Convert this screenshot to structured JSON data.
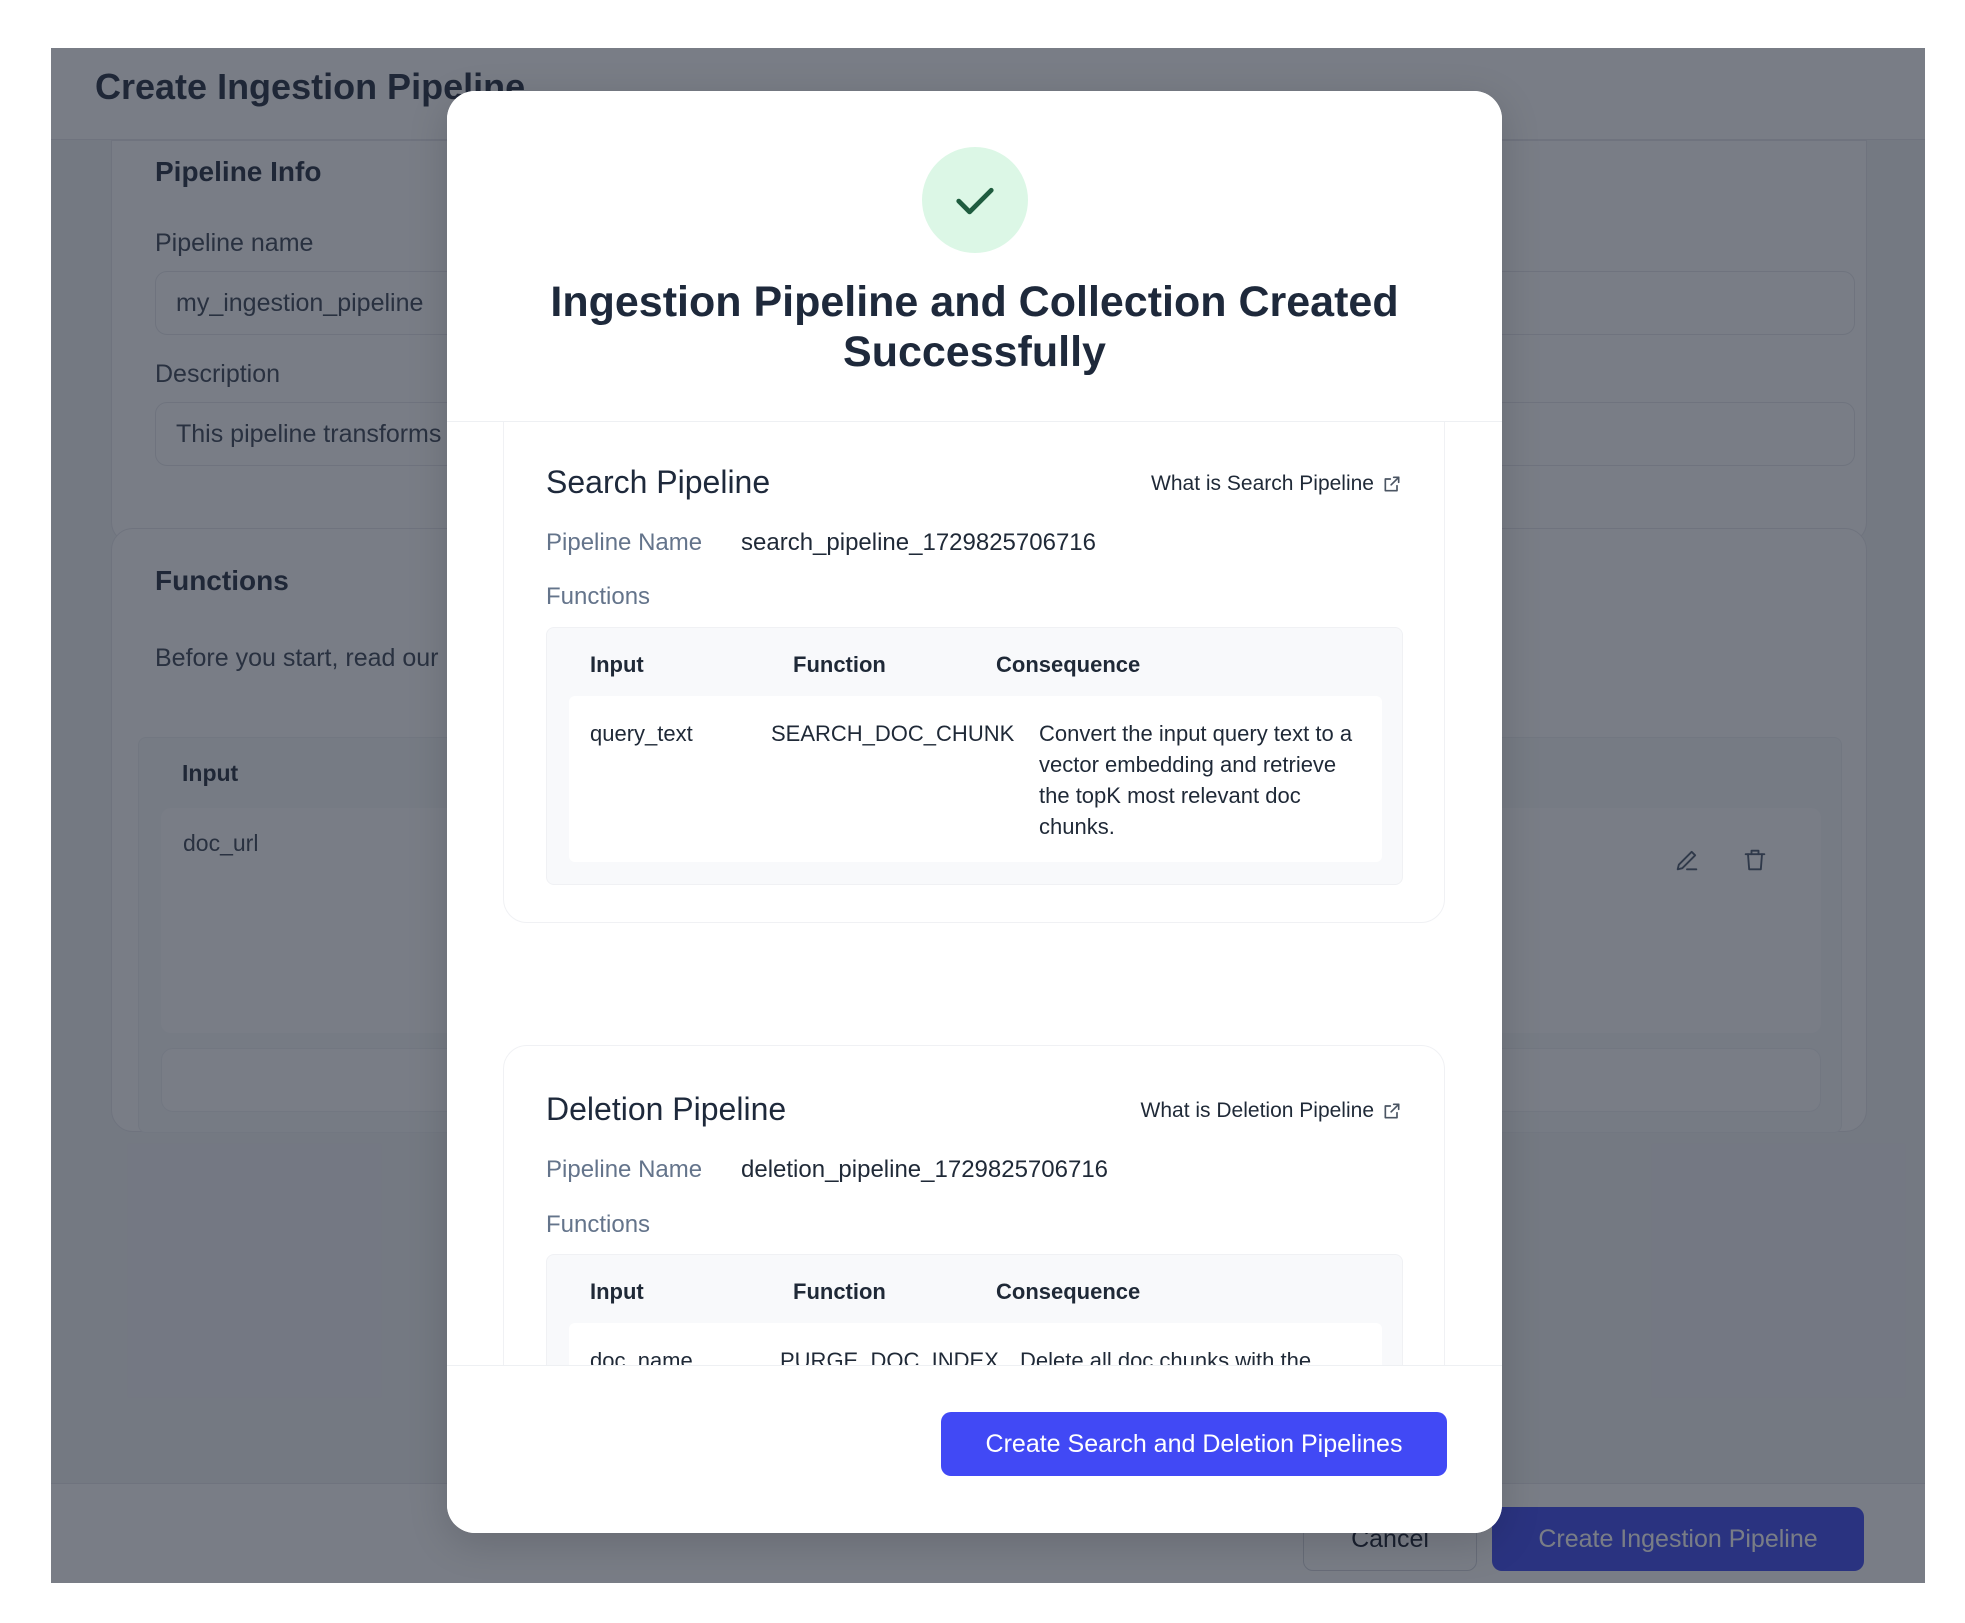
{
  "background": {
    "page_title": "Create Ingestion Pipeline",
    "pipeline_info": {
      "section_title": "Pipeline Info",
      "name_label": "Pipeline name",
      "name_value": "my_ingestion_pipeline",
      "description_label": "Description",
      "description_value": "This pipeline transforms"
    },
    "functions": {
      "section_title": "Functions",
      "intro": "Before you start, read our",
      "table_header_input": "Input",
      "rows": [
        {
          "input": "doc_url"
        }
      ]
    },
    "footer": {
      "cancel_label": "Cancel",
      "create_label": "Create Ingestion Pipeline"
    }
  },
  "modal": {
    "status_icon": "check-icon",
    "title": "Ingestion Pipeline and Collection Created Successfully",
    "search_pipeline": {
      "title": "Search Pipeline",
      "help_link": "What is Search Pipeline",
      "name_label": "Pipeline Name",
      "name_value": "search_pipeline_1729825706716",
      "functions_label": "Functions",
      "columns": [
        "Input",
        "Function",
        "Consequence"
      ],
      "rows": [
        {
          "input": "query_text",
          "function": "SEARCH_DOC_CHUNK",
          "consequence": "Convert the input query text to a vector embedding and retrieve the topK most relevant doc chunks."
        }
      ]
    },
    "deletion_pipeline": {
      "title": "Deletion Pipeline",
      "help_link": "What is Deletion Pipeline",
      "name_label": "Pipeline Name",
      "name_value": "deletion_pipeline_1729825706716",
      "functions_label": "Functions",
      "columns": [
        "Input",
        "Function",
        "Consequence"
      ],
      "rows": [
        {
          "input": "doc_name",
          "function": "PURGE_DOC_INDEX",
          "consequence": "Delete all doc chunks with the specified doc_name."
        }
      ]
    },
    "primary_button": "Create Search and Deletion Pipelines"
  },
  "colors": {
    "primary": "#4149f5",
    "success_bg": "#dcf7e6",
    "success_fg": "#1f5c3f",
    "overlay": "#7a7e89"
  }
}
